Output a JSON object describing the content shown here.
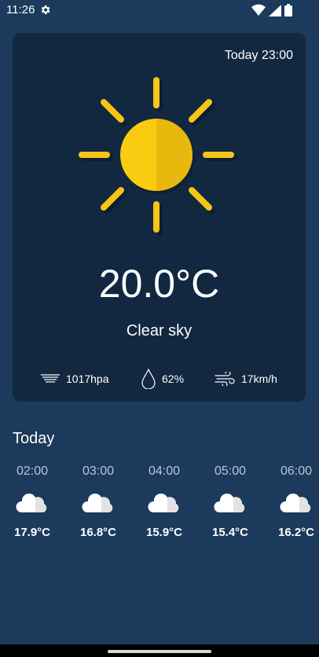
{
  "status_bar": {
    "time": "11:26",
    "icons": [
      "gear-icon",
      "wifi-icon",
      "signal-icon",
      "battery-icon"
    ]
  },
  "current": {
    "datetime": "Today 23:00",
    "temperature": "20.0°C",
    "condition": "Clear sky",
    "icon": "sun-icon",
    "pressure": "1017hpa",
    "humidity": "62%",
    "wind": "17km/h"
  },
  "forecast": {
    "title": "Today",
    "hours": [
      {
        "time": "02:00",
        "temp": "17.9°C",
        "icon": "cloud-icon"
      },
      {
        "time": "03:00",
        "temp": "16.8°C",
        "icon": "cloud-icon"
      },
      {
        "time": "04:00",
        "temp": "15.9°C",
        "icon": "cloud-icon"
      },
      {
        "time": "05:00",
        "temp": "15.4°C",
        "icon": "cloud-icon"
      },
      {
        "time": "06:00",
        "temp": "16.2°C",
        "icon": "cloud-icon"
      }
    ]
  },
  "colors": {
    "background": "#1b3a5c",
    "card": "#122841",
    "sun": "#f5c518",
    "sun_shade": "#e3b40f"
  }
}
